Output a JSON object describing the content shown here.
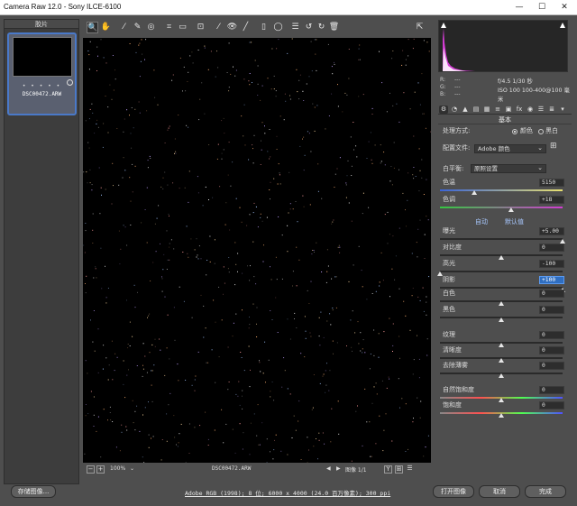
{
  "window": {
    "title": "Camera Raw 12.0 -  Sony ILCE-6100",
    "minimize": "—",
    "maximize": "☐",
    "close": "✕"
  },
  "filmstrip": {
    "header": "胶片",
    "thumb_stars": "• • • • •",
    "thumb_filename": "DSC00472.ARW"
  },
  "toolbar": {
    "tools": [
      {
        "name": "zoom-tool-icon",
        "glyph": "🔍"
      },
      {
        "name": "hand-tool-icon",
        "glyph": "✋"
      },
      {
        "name": "white-balance-tool-icon",
        "glyph": "⁄"
      },
      {
        "name": "color-sampler-tool-icon",
        "glyph": "✎"
      },
      {
        "name": "targeted-adjustment-tool-icon",
        "glyph": "◎"
      },
      {
        "name": "crop-tool-icon",
        "glyph": "⌗"
      },
      {
        "name": "straighten-tool-icon",
        "glyph": "▭"
      },
      {
        "name": "transform-tool-icon",
        "glyph": "⊡"
      },
      {
        "name": "spot-removal-tool-icon",
        "glyph": "⁄"
      },
      {
        "name": "red-eye-tool-icon",
        "glyph": "👁"
      },
      {
        "name": "adjustment-brush-icon",
        "glyph": "╱"
      },
      {
        "name": "graduated-filter-icon",
        "glyph": "▯"
      },
      {
        "name": "radial-filter-icon",
        "glyph": "◯"
      },
      {
        "name": "preferences-icon",
        "glyph": "☰"
      },
      {
        "name": "rotate-ccw-icon",
        "glyph": "↺"
      },
      {
        "name": "rotate-cw-icon",
        "glyph": "↻"
      },
      {
        "name": "delete-icon",
        "glyph": "🗑"
      }
    ],
    "fullscreen_glyph": "⇱"
  },
  "status": {
    "zoom_minus": "−",
    "zoom_plus": "+",
    "zoom_level": "100%",
    "filename": "DSC00472.ARW",
    "prev": "◀",
    "next": "▶",
    "image_count": "图像 1/1",
    "view_y": "Y",
    "view_compare": "⊞",
    "view_menu": "☰"
  },
  "info": {
    "r_label": "R:",
    "g_label": "G:",
    "b_label": "B:",
    "r_value": "---",
    "g_value": "---",
    "b_value": "---",
    "exif_line1": "f/4.5   1/30 秒",
    "exif_line2": "ISO 100   100-400@100 毫米"
  },
  "panel": {
    "tab_glyphs": [
      "⚙",
      "◔",
      "▲",
      "▤",
      "▦",
      "≡",
      "▣",
      "fx",
      "◉",
      "☰",
      "≣",
      "▾"
    ],
    "section_title": "基本",
    "treatment_label": "处理方式:",
    "treatment_color": "颜色",
    "treatment_bw": "黑白",
    "profile_label": "配置文件:",
    "profile_value": "Adobe 颜色",
    "wb_label": "白平衡:",
    "wb_value": "原照设置",
    "auto_link": "自动",
    "default_link": "默认值",
    "sliders": [
      {
        "key": "temp",
        "label": "色温",
        "value": "5150",
        "pos": 0.28
      },
      {
        "key": "tint",
        "label": "色调",
        "value": "+18",
        "pos": 0.58
      },
      {
        "key": "exposure",
        "label": "曝光",
        "value": "+5.00",
        "pos": 1.0
      },
      {
        "key": "contrast",
        "label": "对比度",
        "value": "0",
        "pos": 0.5
      },
      {
        "key": "highlights",
        "label": "高光",
        "value": "-100",
        "pos": 0.0
      },
      {
        "key": "shadows",
        "label": "阴影",
        "value": "+100",
        "pos": 1.0,
        "highlight": true
      },
      {
        "key": "whites",
        "label": "白色",
        "value": "0",
        "pos": 0.5
      },
      {
        "key": "blacks",
        "label": "黑色",
        "value": "0",
        "pos": 0.5
      },
      {
        "key": "texture",
        "label": "纹理",
        "value": "0",
        "pos": 0.5
      },
      {
        "key": "clarity",
        "label": "清晰度",
        "value": "0",
        "pos": 0.5
      },
      {
        "key": "dehaze",
        "label": "去除薄雾",
        "value": "0",
        "pos": 0.5
      },
      {
        "key": "vibrance",
        "label": "自然饱和度",
        "value": "0",
        "pos": 0.5
      },
      {
        "key": "saturation",
        "label": "饱和度",
        "value": "0",
        "pos": 0.5
      }
    ]
  },
  "footer": {
    "save_label": "存储图像...",
    "workflow_info": "Adobe RGB (1998); 8 位; 6000 x 4000 (24.0 百万像素); 300 ppi",
    "open_label": "打开图像",
    "cancel_label": "取消",
    "done_label": "完成"
  },
  "colors": {
    "accent": "#4a79c8",
    "highlight_field": "#2f6ec1",
    "histogram_magenta": "#d23cd2"
  }
}
